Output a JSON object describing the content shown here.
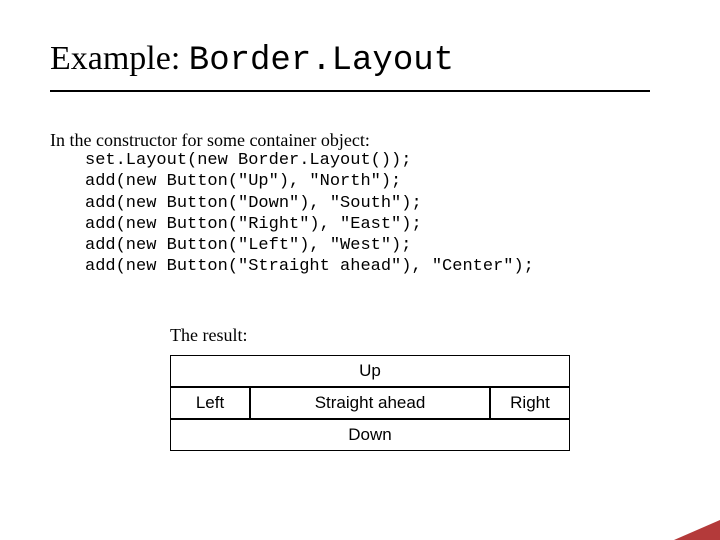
{
  "title": {
    "plain": "Example: ",
    "mono": "Border.Layout"
  },
  "intro": "In the constructor for some container object:",
  "code": {
    "l1": "set.Layout(new Border.Layout());",
    "l2": "add(new Button(\"Up\"), \"North\");",
    "l3": "add(new Button(\"Down\"), \"South\");",
    "l4": "add(new Button(\"Right\"), \"East\");",
    "l5": "add(new Button(\"Left\"), \"West\");",
    "l6": "add(new Button(\"Straight ahead\"), \"Center\");"
  },
  "result_label": "The result:",
  "layout": {
    "north": "Up",
    "west": "Left",
    "center": "Straight ahead",
    "east": "Right",
    "south": "Down"
  }
}
